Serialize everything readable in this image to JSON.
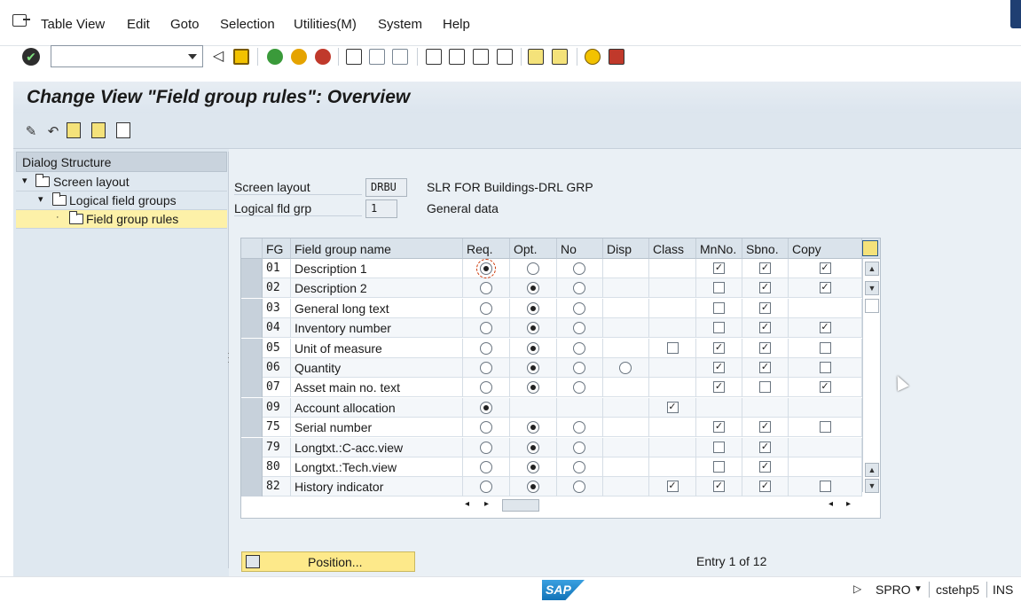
{
  "menu": {
    "items": [
      "Table View",
      "Edit",
      "Goto",
      "Selection",
      "Utilities(M)",
      "System",
      "Help"
    ]
  },
  "toolbar": {
    "command_field_value": ""
  },
  "title": "Change View \"Field group rules\": Overview",
  "dialog_structure": {
    "heading": "Dialog Structure",
    "nodes": [
      {
        "label": "Screen layout",
        "level": 0
      },
      {
        "label": "Logical field groups",
        "level": 1
      },
      {
        "label": "Field group rules",
        "level": 2,
        "selected": true
      }
    ]
  },
  "header": {
    "screen_layout_label": "Screen layout",
    "screen_layout_value": "DRBU",
    "screen_layout_desc": "SLR FOR Buildings-DRL GRP",
    "logical_fld_grp_label": "Logical fld grp",
    "logical_fld_grp_value": "1",
    "logical_fld_grp_desc": "General data"
  },
  "table": {
    "columns": [
      "FG",
      "Field group name",
      "Req.",
      "Opt.",
      "No",
      "Disp",
      "Class",
      "MnNo.",
      "Sbno.",
      "Copy"
    ],
    "rows": [
      {
        "fg": "01",
        "name": "Description 1",
        "sel": "req",
        "disp": false,
        "cls": null,
        "mn": true,
        "sb": true,
        "copy": true
      },
      {
        "fg": "02",
        "name": "Description 2",
        "sel": "opt",
        "disp": false,
        "cls": null,
        "mn": false,
        "sb": true,
        "copy": true
      },
      {
        "fg": "03",
        "name": "General long text",
        "sel": "opt",
        "disp": false,
        "cls": null,
        "mn": false,
        "sb": true,
        "copy": null
      },
      {
        "fg": "04",
        "name": "Inventory number",
        "sel": "opt",
        "disp": false,
        "cls": null,
        "mn": false,
        "sb": true,
        "copy": true
      },
      {
        "fg": "05",
        "name": "Unit of measure",
        "sel": "opt",
        "disp": false,
        "cls": false,
        "mn": true,
        "sb": true,
        "copy": false
      },
      {
        "fg": "06",
        "name": "Quantity",
        "sel": "opt",
        "disp": true,
        "cls": null,
        "mn": true,
        "sb": true,
        "copy": false
      },
      {
        "fg": "07",
        "name": "Asset main no. text",
        "sel": "opt",
        "disp": false,
        "cls": null,
        "mn": true,
        "sb": false,
        "copy": true
      },
      {
        "fg": "09",
        "name": "Account allocation",
        "sel": "req_only",
        "disp": false,
        "cls": true,
        "mn": null,
        "sb": null,
        "copy": null
      },
      {
        "fg": "75",
        "name": "Serial number",
        "sel": "opt",
        "disp": false,
        "cls": null,
        "mn": true,
        "sb": true,
        "copy": false
      },
      {
        "fg": "79",
        "name": "Longtxt.:C-acc.view",
        "sel": "opt",
        "disp": false,
        "cls": null,
        "mn": false,
        "sb": true,
        "copy": null
      },
      {
        "fg": "80",
        "name": "Longtxt.:Tech.view",
        "sel": "opt",
        "disp": false,
        "cls": null,
        "mn": false,
        "sb": true,
        "copy": null
      },
      {
        "fg": "82",
        "name": "History indicator",
        "sel": "opt",
        "disp": false,
        "cls": true,
        "mn": true,
        "sb": true,
        "copy": false
      }
    ]
  },
  "footer": {
    "position_label": "Position...",
    "entry_text": "Entry 1 of 12"
  },
  "status": {
    "system": "SPRO",
    "server": "cstehp5",
    "mode": "INS",
    "logo": "SAP"
  }
}
